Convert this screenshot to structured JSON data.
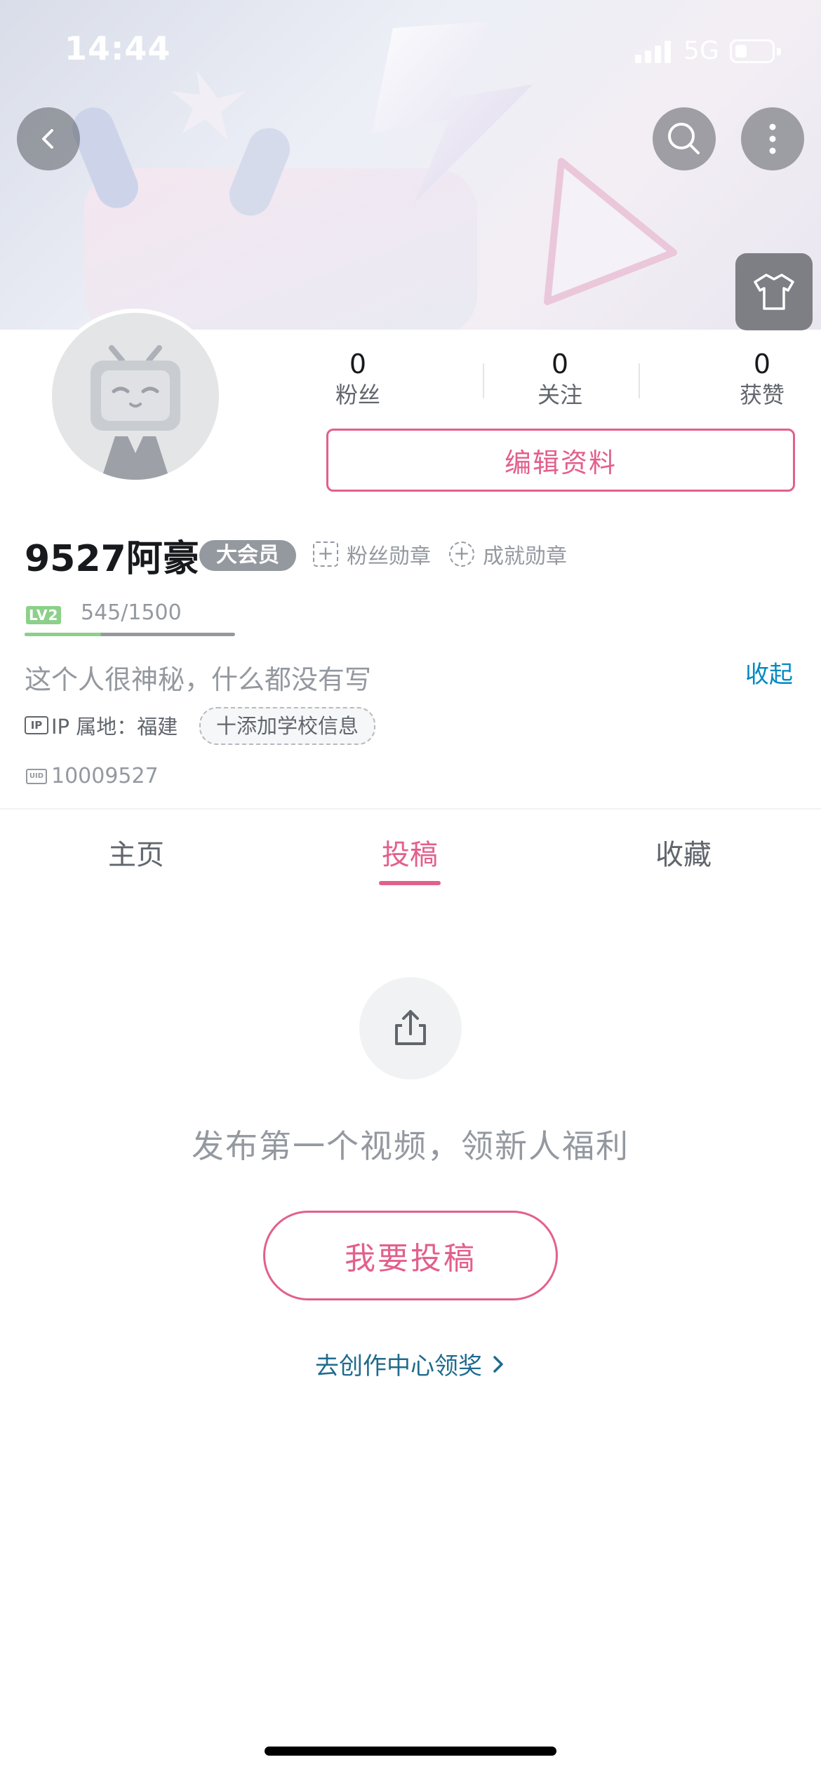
{
  "status_bar": {
    "time": "14:44",
    "network": "5G"
  },
  "header": {
    "back_icon": "chevron-left-icon",
    "search_icon": "search-icon",
    "more_icon": "more-vertical-icon",
    "theme_icon": "tshirt-icon"
  },
  "profile": {
    "stats": [
      {
        "value": "0",
        "label": "粉丝"
      },
      {
        "value": "0",
        "label": "关注"
      },
      {
        "value": "0",
        "label": "获赞"
      }
    ],
    "edit_label": "编辑资料",
    "name": "9527阿豪",
    "vip_badge": "大会员",
    "fan_medal": "粉丝勋章",
    "achievement_medal": "成就勋章",
    "level_badge": "LV2",
    "level_progress": 0.363,
    "exp": "545/1500",
    "bio": "这个人很神秘，什么都没有写",
    "collapse_label": "收起",
    "ip_icon": "IP",
    "ip_location": "IP 属地：福建",
    "school_tag": "十添加学校信息",
    "uid_icon": "UID",
    "uid": "10009527"
  },
  "tabs": [
    {
      "label": "主页",
      "active": false
    },
    {
      "label": "投稿",
      "active": true
    },
    {
      "label": "收藏",
      "active": false
    }
  ],
  "empty_state": {
    "icon": "upload-icon",
    "message": "发布第一个视频，领新人福利",
    "button_label": "我要投稿",
    "link_label": "去创作中心领奖"
  },
  "colors": {
    "accent": "#e2608b",
    "link": "#1f6b8e",
    "level": "#8cd089",
    "muted": "#9499a0"
  }
}
